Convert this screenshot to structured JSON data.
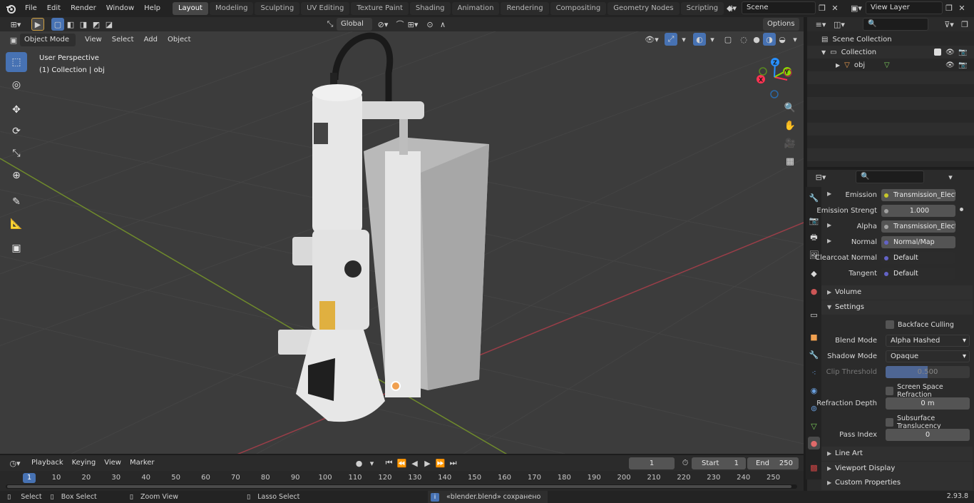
{
  "topbar": {
    "menus": [
      "File",
      "Edit",
      "Render",
      "Window",
      "Help"
    ],
    "workspaces": [
      "Layout",
      "Modeling",
      "Sculpting",
      "UV Editing",
      "Texture Paint",
      "Shading",
      "Animation",
      "Rendering",
      "Compositing",
      "Geometry Nodes",
      "Scripting"
    ],
    "active_workspace": "Layout",
    "scene": "Scene",
    "view_layer": "View Layer"
  },
  "viewport_header": {
    "mode": "Object Mode",
    "menus": [
      "View",
      "Select",
      "Add",
      "Object"
    ],
    "transform_orientation": "Global",
    "options": "Options"
  },
  "viewport": {
    "perspective": "User Perspective",
    "collection_info": "(1) Collection | obj",
    "gizmo": {
      "x": "X",
      "y": "Y",
      "z": "Z"
    }
  },
  "outliner": {
    "scene_collection": "Scene Collection",
    "collection": "Collection",
    "object": "obj"
  },
  "properties": {
    "rows": [
      {
        "label": "Emission",
        "value": "Transmission_Electr...",
        "color": "#c7c729",
        "expandable": true
      },
      {
        "label": "Emission Strengt",
        "value": "1.000",
        "color": "#a1a1a1",
        "expandable": false,
        "numeric": true
      },
      {
        "label": "Alpha",
        "value": "Transmission_Electr...",
        "color": "#a1a1a1",
        "expandable": true
      },
      {
        "label": "Normal",
        "value": "Normal/Map",
        "color": "#6363c7",
        "expandable": true
      },
      {
        "label": "Clearcoat Normal",
        "value": "Default",
        "color": "#6363c7",
        "expandable": false
      },
      {
        "label": "Tangent",
        "value": "Default",
        "color": "#6363c7",
        "expandable": false
      }
    ],
    "volume": "Volume",
    "settings": "Settings",
    "backface_culling": "Backface Culling",
    "blend_mode_label": "Blend Mode",
    "blend_mode": "Alpha Hashed",
    "shadow_mode_label": "Shadow Mode",
    "shadow_mode": "Opaque",
    "clip_threshold_label": "Clip Threshold",
    "clip_threshold": "0.500",
    "ssr": "Screen Space Refraction",
    "refraction_depth_label": "Refraction Depth",
    "refraction_depth": "0 m",
    "subsurface": "Subsurface Translucency",
    "pass_index_label": "Pass Index",
    "pass_index": "0",
    "line_art": "Line Art",
    "viewport_display": "Viewport Display",
    "custom_properties": "Custom Properties"
  },
  "timeline": {
    "menus": [
      "Playback",
      "Keying",
      "View",
      "Marker"
    ],
    "current_frame": "1",
    "start_label": "Start",
    "start": "1",
    "end_label": "End",
    "end": "250",
    "ticks": [
      "1",
      "10",
      "20",
      "30",
      "40",
      "50",
      "60",
      "70",
      "80",
      "90",
      "100",
      "110",
      "120",
      "130",
      "140",
      "150",
      "160",
      "170",
      "180",
      "190",
      "200",
      "210",
      "220",
      "230",
      "240",
      "250"
    ]
  },
  "statusbar": {
    "select": "Select",
    "box_select": "Box Select",
    "zoom_view": "Zoom View",
    "lasso_select": "Lasso Select",
    "message": "«blender.blend» сохранено",
    "version": "2.93.8"
  },
  "colors": {
    "accent": "#4772b3",
    "x_axis": "#ff3352",
    "y_axis": "#8bdc00",
    "z_axis": "#2890ff"
  }
}
